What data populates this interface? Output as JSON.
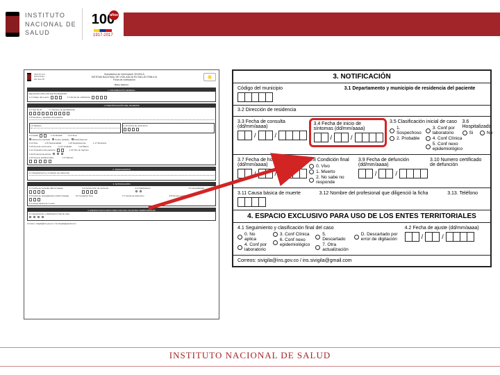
{
  "header": {
    "institute": "INSTITUTO",
    "nacional": "NACIONAL DE",
    "salud": "SALUD",
    "hundred": "100",
    "anos": "años",
    "years": "1917-2017"
  },
  "thumb": {
    "ins1": "INSTITUTO",
    "ins2": "NACIONAL",
    "ins3": "DE SALUD",
    "title1": "Subsistema de información SIVIGILA",
    "title2": "SISTEMA NACIONAL DE VIGILANCIA EN SALUD PÚBLICA",
    "title3": "Ficha de notificación",
    "datos": "Datos básicos",
    "sec1": "1. INFORMACIÓN GENERAL",
    "reg": "RELACIÓN CON LOS DATOS BÁSICOS",
    "evento": "1.2 Código del evento",
    "fecha_not": "1.3 Fecha de notificación",
    "sec1b": "1.5 IDENTIFICACIÓN DEL PACIENTE",
    "tipo_doc": "1.6 Tipo de ID",
    "num_id": "1.7 Número de identificación",
    "nombres": "1.8 Nombres y apellidos del paciente",
    "tel": "1.9 Teléfono",
    "fnac": "1.10 Fecha de nacimiento",
    "edad": "1.11 Edad",
    "umed": "1.12 Medida",
    "sexo": "1.13 Sexo",
    "pais": "1.14 País",
    "nac": "1.15 Nacionalidad",
    "dep": "1.16 Departamento",
    "mun": "1.17 Municipio",
    "area": "1.18 Área de ocurrencia",
    "loc": "1.19 Localidad",
    "bar": "1.20 Barrio",
    "cab": "Cabecera municipal",
    "cp": "Centro poblado",
    "rd": "Rural disperso",
    "ocup": "1.21 Ocupación del paciente",
    "reg2": "1.22 Tipo de régimen",
    "per": "1.23 Pertenencia étnica",
    "grp": "1.24 Grupos poblacionales",
    "estr": "1.17 Estrato",
    "sec2": "2. DESPLAZADOS",
    "fuente": "2.1 Departamento y municipio de referencia",
    "sec3": "3. NOTIFICACIÓN",
    "f31": "3.1 Fecha de consulta (dd/mm/aaaa)",
    "f32": "3.2 Fecha inicio de síntomas",
    "clas": "3.3 Clasificación",
    "hosp": "3.4 Hospitalizado",
    "fhosp": "3.5 Fecha de hospitalización (dd/mm/aaaa)",
    "cond": "3.6 Condición final",
    "fdef": "3.7 Fecha de defunción",
    "cert": "3.8 Numero certificado",
    "causa": "3.9 Causa básica de muerte",
    "sec4": "4. ESPACIO EXCLUSIVO PARA USO DE LOS ENTES TERRITORIALES",
    "seg": "4.1 Seguimiento y clasificación final de caso",
    "correo": "Correos: sivigila@ins.gov.co / ins.sivigila@gmail.com"
  },
  "zoom": {
    "sec3_title": "3. NOTIFICACIÓN",
    "f_cod": "Código del municipio",
    "f_31": "3.1 Departamento y municipio de residencia del paciente",
    "f_32": "3.2 Dirección de residencia",
    "f_33": "3.3 Fecha de consulta (dd/mm/aaaa)",
    "f_34": "3.4 Fecha de inicio de síntomas (dd/mm/aaaa)",
    "f_35": "3.5 Clasificación inicial de caso",
    "f_36": "3.6 Hospitalizado",
    "o_sosp": "1. Sospechoso",
    "o_prob": "2. Probable",
    "o_conflab": "3. Conf por laboratorio",
    "o_confcl": "4. Conf Clínica",
    "o_confnex": "5. Conf nexo epidemiológico",
    "o_si": "Si",
    "o_no": "No",
    "f_37": "3.7 Fecha de hospitalización (dd/mm/aaaa)",
    "f_38": "3.8 Condición final",
    "o_vivo": "0. Vivo",
    "o_muerto": "1. Muerto",
    "o_nsnr": "2. No sabe no responde",
    "f_39": "3.9 Fecha de defunción (dd/mm/aaaa)",
    "f_310": "3.10 Numero certificado de defunción",
    "f_311": "3.11 Causa básica de muerte",
    "f_312": "3.12 Nombre del profesional que diligenció la ficha",
    "f_313": "3.13. Teléfono",
    "sec4_title": "4. ESPACIO EXCLUSIVO PARA USO DE LOS ENTES TERRITORIALES",
    "f_41": "4.1 Seguimiento y clasificación final del caso",
    "f_42": "4.2 Fecha de ajuste (dd/mm/aaaa)",
    "o41_0": "0. No aplica",
    "o41_3": "3. Conf Clínica",
    "o41_5": "5. Descartado",
    "o41_4": "4. Conf por laboratorio",
    "o41_6": "6. Conf nexo epidemiológico",
    "o41_7": "7. Otra actualización",
    "o41_D": "D. Descartado por error de digitación",
    "correos": "Correos: sivigila@ins.gov.co / ins.sivigila@gmail.com"
  },
  "footer": "INSTITUTO NACIONAL DE SALUD"
}
